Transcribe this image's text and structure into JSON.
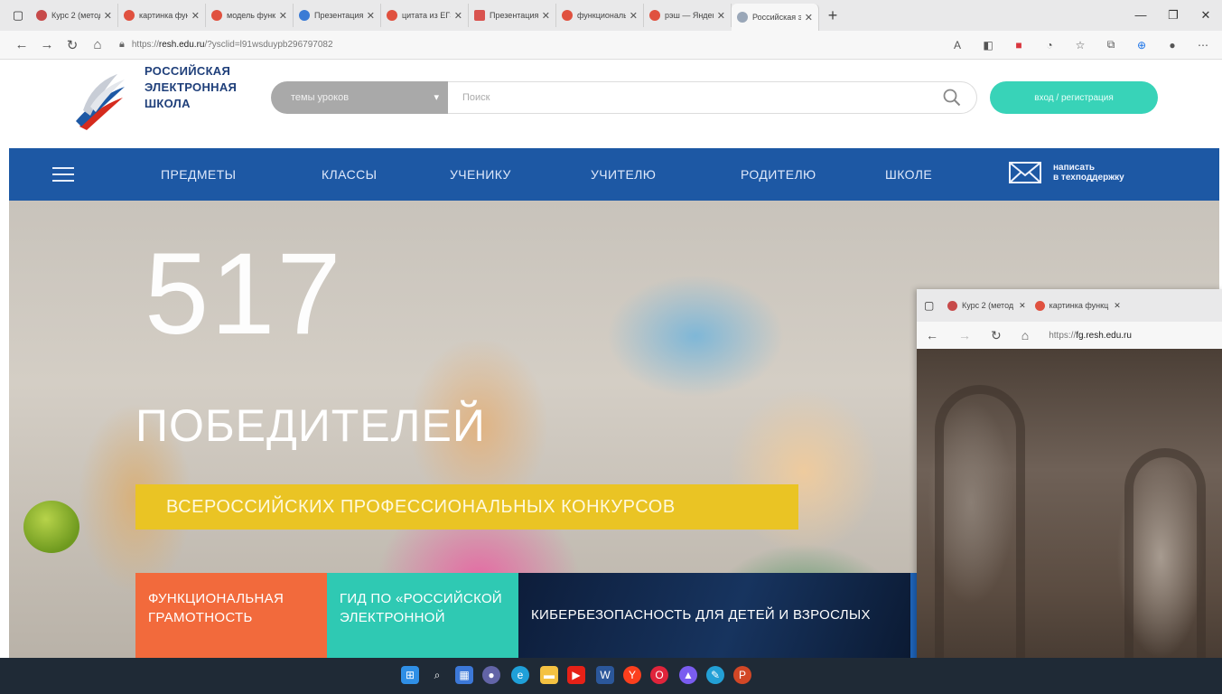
{
  "browser": {
    "tabs": [
      {
        "label": "Курс 2 (метод",
        "color": "#c74a4a"
      },
      {
        "label": "картинка функц",
        "color": "#e0513f"
      },
      {
        "label": "модель функц",
        "color": "#e0513f"
      },
      {
        "label": "Презентация",
        "color": "#3a7bd5"
      },
      {
        "label": "цитата из ЕГЭ",
        "color": "#e0513f"
      },
      {
        "label": "Презентация",
        "color": "#d9534f"
      },
      {
        "label": "функциональн",
        "color": "#e0513f"
      },
      {
        "label": "рэш — Яндекс",
        "color": "#e0513f"
      },
      {
        "label": "Российская эл",
        "color": "#9aa7b8"
      }
    ],
    "url_prefix": "https://",
    "url_host": "resh.edu.ru",
    "url_rest": "/?ysclid=l91wsduypb296797082"
  },
  "header": {
    "logo_lines": [
      "РОССИЙСКАЯ",
      "ЭЛЕКТРОННАЯ",
      "ШКОЛА"
    ],
    "themes_label": "темы уроков",
    "search_placeholder": "Поиск",
    "login_label": "вход / регистрация"
  },
  "nav": {
    "items": [
      "ПРЕДМЕТЫ",
      "КЛАССЫ",
      "УЧЕНИКУ",
      "УЧИТЕЛЮ",
      "РОДИТЕЛЮ",
      "ШКОЛЕ"
    ],
    "support_line1": "написать",
    "support_line2": "в техподдержку"
  },
  "hero": {
    "number": "517",
    "word": "ПОБЕДИТЕЛЕЙ",
    "band": "ВСЕРОССИЙСКИХ ПРОФЕССИОНАЛЬНЫХ КОНКУРСОВ",
    "tile1": "ФУНКЦИОНАЛЬНАЯ ГРАМОТНОСТЬ",
    "tile2": "ГИД ПО «РОССИЙСКОЙ ЭЛЕКТРОННОЙ",
    "tile3": "КИБЕРБЕЗОПАСНОСТЬ ДЛЯ ДЕТЕЙ И ВЗРОСЛЫХ"
  },
  "overlay": {
    "tab1": "Курс 2 (метод",
    "tab2": "картинка функц",
    "url_prefix": "https://",
    "url_host": "fg.resh.edu.ru"
  },
  "taskbar": {
    "icons": [
      "windows-icon",
      "search-icon",
      "widgets-icon",
      "teams-chat-icon",
      "edge-icon",
      "file-explorer-icon",
      "youtube-icon",
      "word-icon",
      "yandex-icon",
      "opera-icon",
      "app-icon",
      "paint-icon",
      "powerpoint-icon"
    ]
  }
}
